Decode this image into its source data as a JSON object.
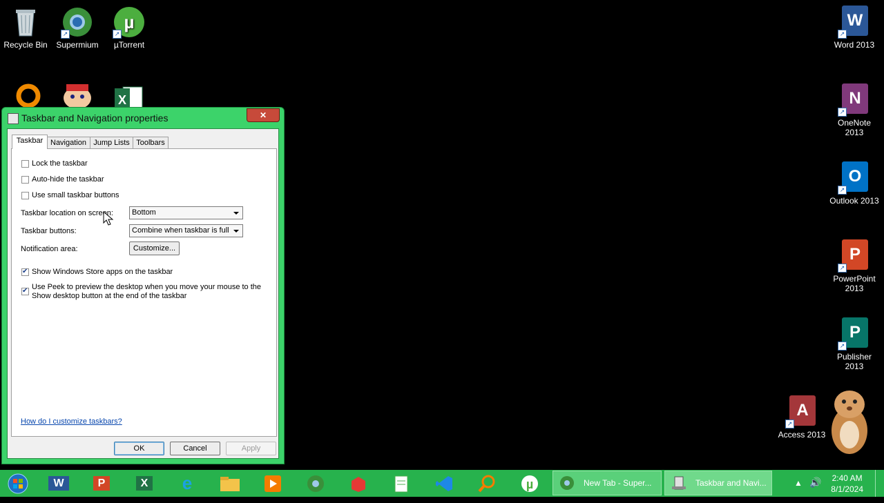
{
  "desktop": {
    "icons_left": [
      {
        "label": "Recycle Bin",
        "icon": "recycle-bin-icon"
      },
      {
        "label": "Supermium",
        "icon": "supermium-icon"
      },
      {
        "label": "µTorrent",
        "icon": "utorrent-icon"
      }
    ],
    "icons_right": [
      {
        "label": "Word 2013",
        "letter": "W",
        "color": "#2b5797"
      },
      {
        "label": "OneNote 2013",
        "letter": "N",
        "color": "#80397b"
      },
      {
        "label": "Outlook 2013",
        "letter": "O",
        "color": "#0072c6"
      },
      {
        "label": "PowerPoint 2013",
        "letter": "P",
        "color": "#d24726"
      },
      {
        "label": "Publisher 2013",
        "letter": "P",
        "color": "#077568"
      },
      {
        "label": "Access 2013",
        "letter": "A",
        "color": "#a4373a"
      }
    ]
  },
  "dialog": {
    "title": "Taskbar and Navigation properties",
    "close_label": "✕",
    "tabs": [
      "Taskbar",
      "Navigation",
      "Jump Lists",
      "Toolbars"
    ],
    "options": {
      "lock": "Lock the taskbar",
      "autohide": "Auto-hide the taskbar",
      "small": "Use small taskbar buttons",
      "store_apps": "Show Windows Store apps on the taskbar",
      "peek_line1": "Use Peek to preview the desktop when you move your mouse to the",
      "peek_line2": "Show desktop button at the end of the taskbar"
    },
    "location_label": "Taskbar location on screen:",
    "location_value": "Bottom",
    "buttons_label": "Taskbar buttons:",
    "buttons_value": "Combine when taskbar is full",
    "notification_label": "Notification area:",
    "customize_label": "Customize...",
    "help_link": "How do I customize taskbars?",
    "ok": "OK",
    "cancel": "Cancel",
    "apply": "Apply"
  },
  "taskbar": {
    "task1": "New Tab - Super...",
    "task2": "Taskbar and Navi...",
    "time": "2:40 AM",
    "date": "8/1/2024",
    "accent": "#27b24d"
  }
}
